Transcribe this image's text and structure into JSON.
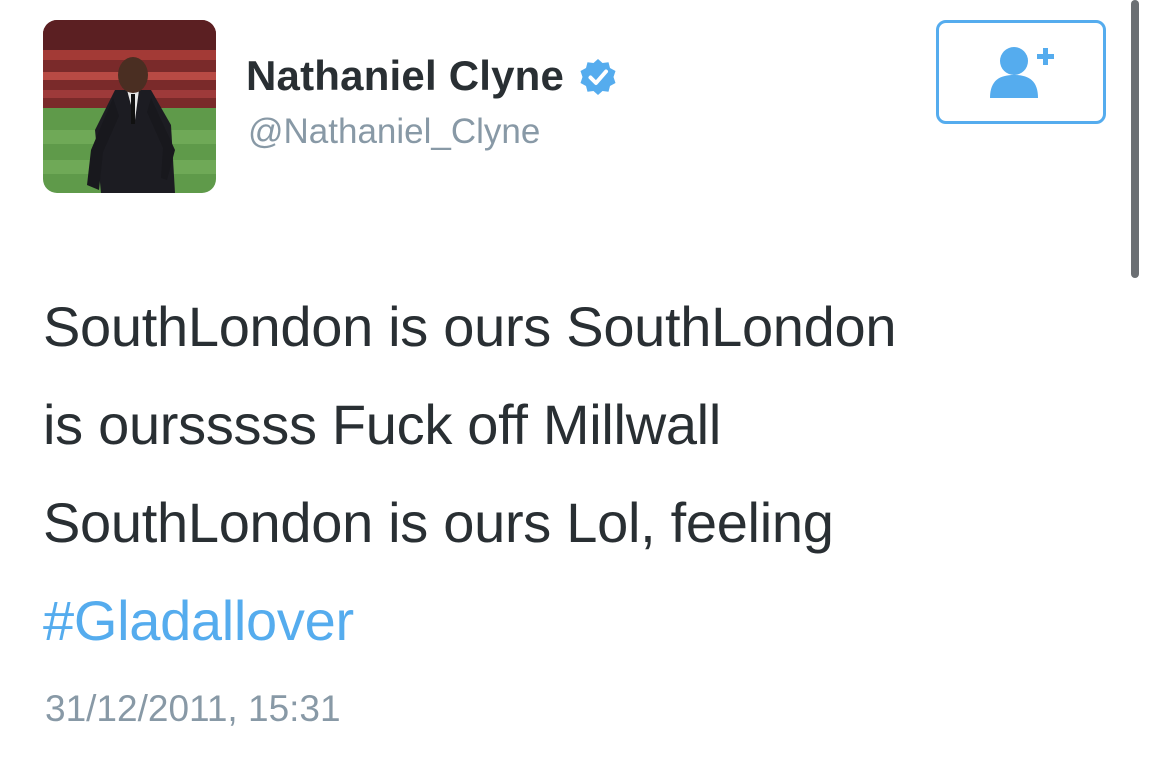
{
  "user": {
    "display_name": "Nathaniel Clyne",
    "handle": "@Nathaniel_Clyne",
    "verified": true
  },
  "follow_button": {
    "icon": "add-user-icon"
  },
  "tweet": {
    "lines": [
      "SouthLondon is ours SouthLondon",
      "is oursssss Fuck off Millwall",
      "SouthLondon is ours Lol, feeling"
    ],
    "hashtag": "#Gladallover",
    "timestamp": "31/12/2011, 15:31"
  },
  "colors": {
    "accent": "#55acee",
    "text": "#292f33",
    "muted": "#8899a6"
  }
}
